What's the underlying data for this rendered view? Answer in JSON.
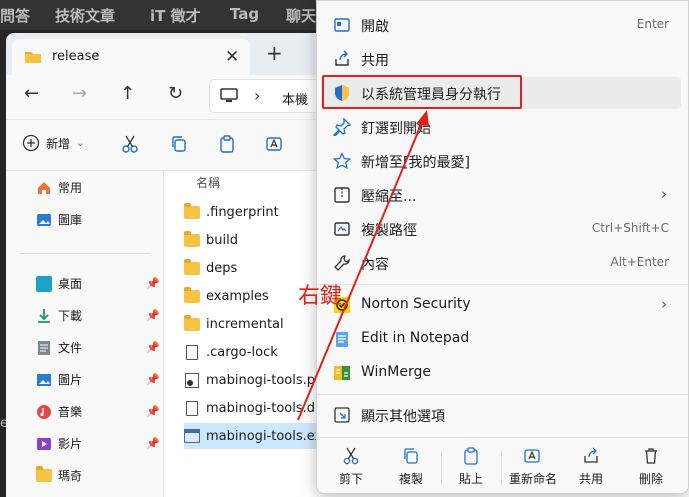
{
  "background_site": {
    "nav": [
      "問答",
      "技術文章",
      "iT 徵才",
      "Tag",
      "聊天"
    ]
  },
  "background_left_text": "e",
  "explorer": {
    "tab_title": "release",
    "address": "本機",
    "toolbar": {
      "new_label": "新增"
    },
    "sidebar": {
      "top": [
        {
          "label": "常用",
          "icon": "home-icon",
          "color": "#e8743b"
        },
        {
          "label": "圖庫",
          "icon": "gallery-icon",
          "color": "#2b7bd6"
        }
      ],
      "pinned": [
        {
          "label": "桌面",
          "icon": "desktop-icon",
          "color": "#1aa3c7"
        },
        {
          "label": "下載",
          "icon": "download-icon",
          "color": "#1c9b5a"
        },
        {
          "label": "文件",
          "icon": "documents-icon",
          "color": "#7b8794"
        },
        {
          "label": "圖片",
          "icon": "pictures-icon",
          "color": "#2b7bd6"
        },
        {
          "label": "音樂",
          "icon": "music-icon",
          "color": "#e04a4a"
        },
        {
          "label": "影片",
          "icon": "videos-icon",
          "color": "#8a3fd1"
        },
        {
          "label": "瑪奇",
          "icon": "folder-icon",
          "color": "#f6c343"
        }
      ]
    },
    "column_header": "名稱",
    "files": [
      {
        "name": ".fingerprint",
        "type": "folder"
      },
      {
        "name": "build",
        "type": "folder"
      },
      {
        "name": "deps",
        "type": "folder"
      },
      {
        "name": "examples",
        "type": "folder"
      },
      {
        "name": "incremental",
        "type": "folder"
      },
      {
        "name": ".cargo-lock",
        "type": "file"
      },
      {
        "name": "mabinogi-tools.pdb",
        "type": "pdb"
      },
      {
        "name": "mabinogi-tools.d",
        "type": "file"
      },
      {
        "name": "mabinogi-tools.exe",
        "type": "exe",
        "selected": true
      }
    ]
  },
  "annotation": "右鍵",
  "context_menu": {
    "items": [
      {
        "label": "開啟",
        "shortcut": "Enter",
        "icon": "open-icon"
      },
      {
        "label": "共用",
        "icon": "share-icon"
      },
      {
        "label": "以系統管理員身分執行",
        "icon": "shield-icon",
        "highlighted": true
      },
      {
        "label": "釘選到開始",
        "icon": "pin-icon"
      },
      {
        "label": "新增至[我的最愛]",
        "icon": "star-icon"
      },
      {
        "label": "壓縮至...",
        "icon": "zip-icon",
        "submenu": true
      },
      {
        "label": "複製路徑",
        "shortcut": "Ctrl+Shift+C",
        "icon": "copy-path-icon"
      },
      {
        "label": "內容",
        "shortcut": "Alt+Enter",
        "icon": "wrench-icon"
      },
      {
        "label": "Norton Security",
        "icon": "norton-icon",
        "submenu": true
      },
      {
        "label": "Edit in Notepad",
        "icon": "notepad-icon"
      },
      {
        "label": "WinMerge",
        "icon": "winmerge-icon"
      },
      {
        "label": "顯示其他選項",
        "icon": "more-options-icon"
      }
    ],
    "actions": [
      {
        "label": "剪下",
        "icon": "cut-icon"
      },
      {
        "label": "複製",
        "icon": "copy-icon"
      },
      {
        "label": "貼上",
        "icon": "paste-icon"
      },
      {
        "label": "重新命名",
        "icon": "rename-icon"
      },
      {
        "label": "共用",
        "icon": "share-icon"
      },
      {
        "label": "刪除",
        "icon": "trash-icon"
      }
    ]
  },
  "colors": {
    "accent_red": "#e0201a",
    "selection": "#cce8ff",
    "menu_bg": "#f9f9f9",
    "icon_blue": "#1f6fd1"
  }
}
